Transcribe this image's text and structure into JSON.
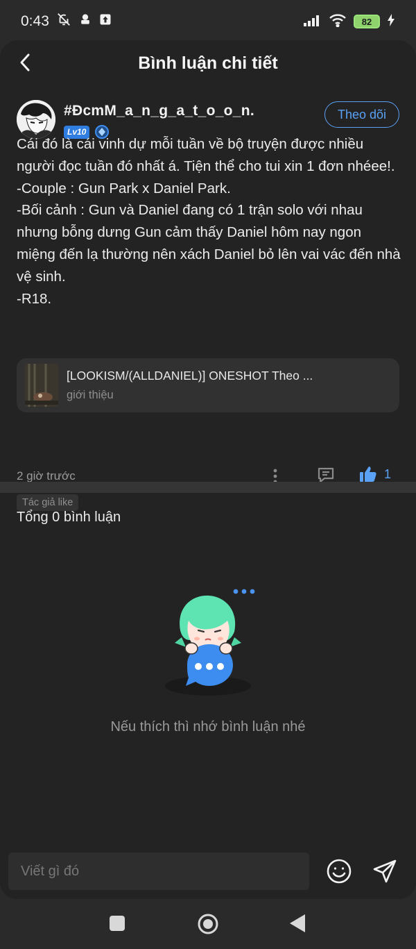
{
  "status_bar": {
    "time": "0:43",
    "battery": "82"
  },
  "header": {
    "title": "Bình luận chi tiết"
  },
  "post": {
    "author_name": "#ĐcmM_a_n_g_a_t_o_o_n.",
    "level_badge": "Lv10",
    "follow_label": "Theo dõi",
    "body_lines": [
      "Cái đó là cái vinh dự mỗi tuần về bộ truyện được nhiều người đọc tuần đó nhất á. Tiện thể cho tui xin 1 đơn nhéee!.",
      "-Couple : Gun Park x Daniel Park.",
      "-Bối cảnh : Gun và Daniel đang có 1 trận solo với nhau nhưng bỗng dưng Gun cảm thấy Daniel hôm nay ngon miệng đến lạ thường nên xách Daniel bỏ lên vai vác đến nhà vệ sinh.",
      "-R18."
    ],
    "link_card": {
      "title": "[LOOKISM/(ALLDANIEL)] ONESHOT Theo ...",
      "subtitle": "giới thiệu"
    },
    "time_ago": "2 giờ trước",
    "like_count": "1",
    "author_like_tag": "Tác giả like"
  },
  "comments": {
    "header": "Tổng 0 bình luận",
    "empty_text": "Nếu thích thì nhớ bình luận nhé"
  },
  "input": {
    "placeholder": "Viết gì đó"
  },
  "colors": {
    "accent": "#5aa2f5",
    "background": "#232323"
  }
}
